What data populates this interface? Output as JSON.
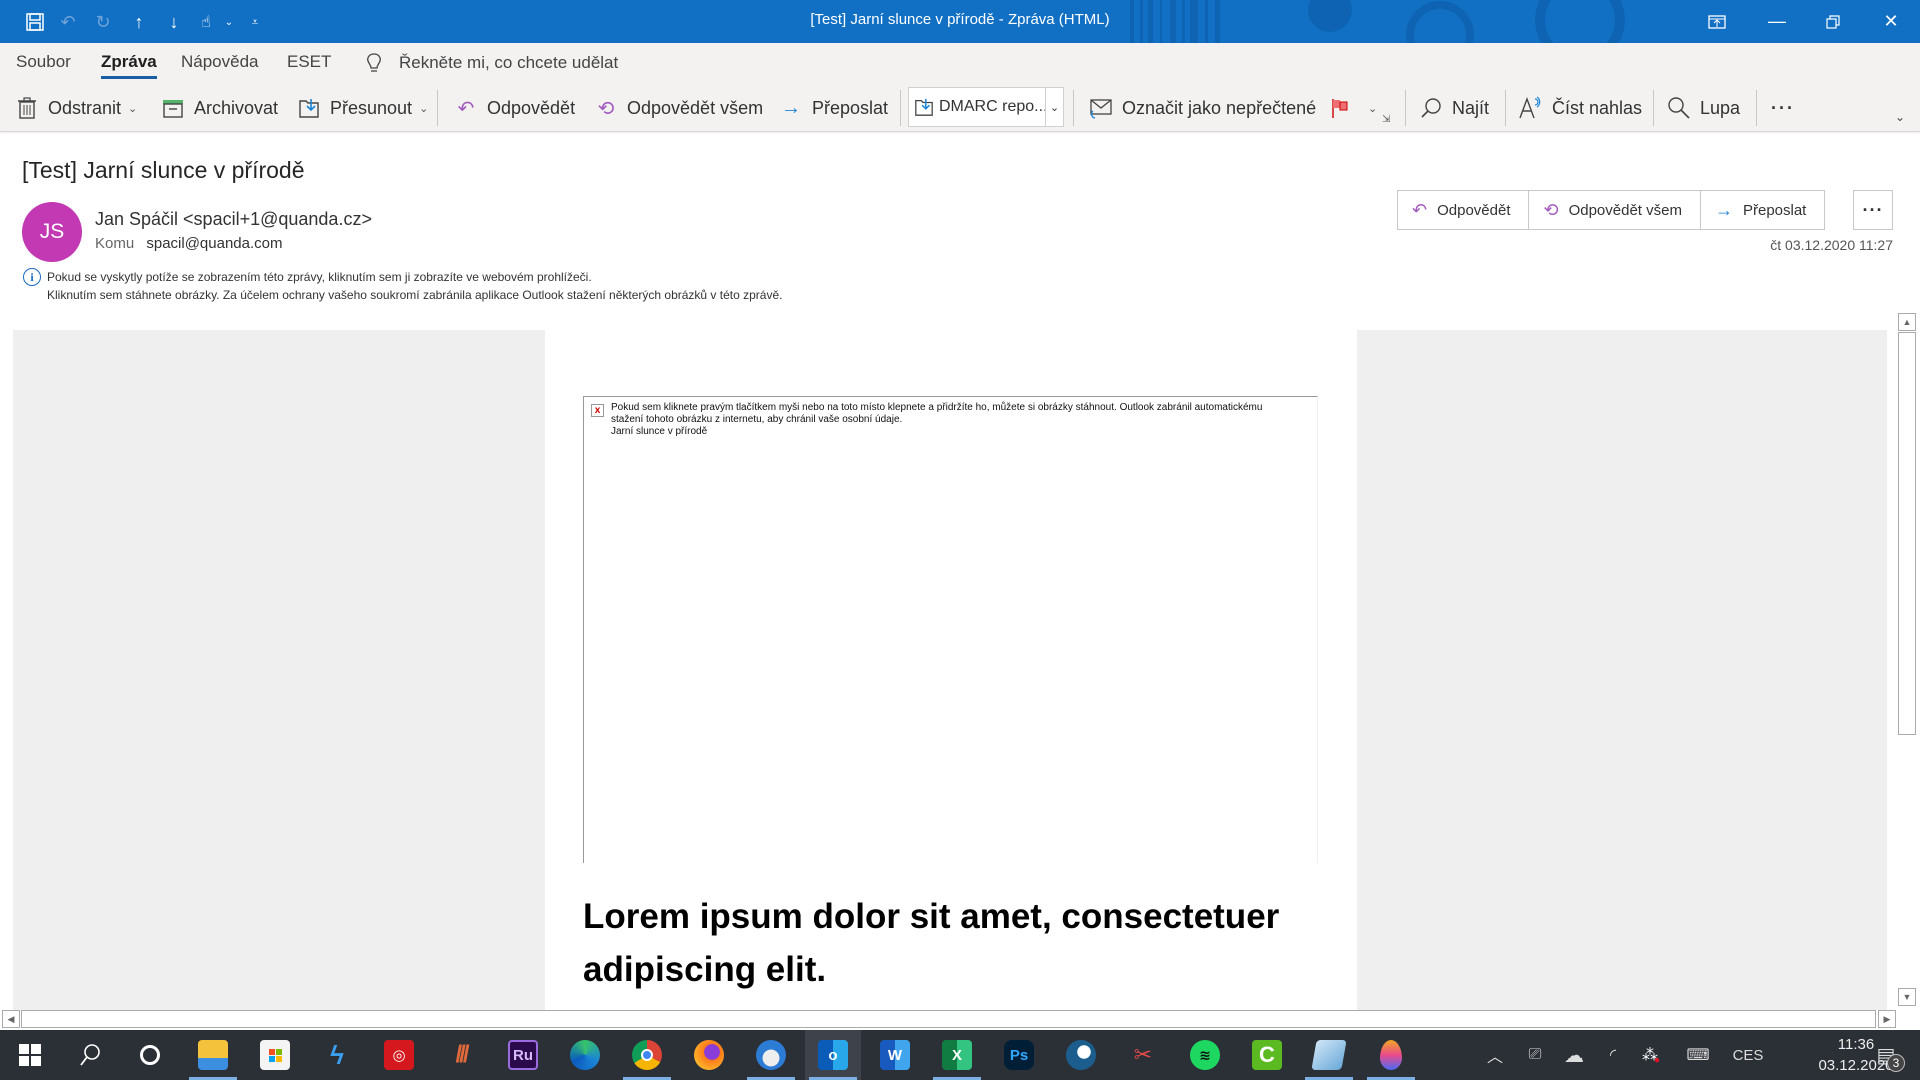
{
  "window": {
    "title": "[Test] Jarní slunce v přírodě  -  Zpráva (HTML)",
    "quick_access": [
      "save-icon",
      "undo-icon",
      "redo-icon",
      "previous-item-icon",
      "next-item-icon",
      "touch-mode-icon",
      "customize-icon"
    ],
    "controls": [
      "ribbon-display-options",
      "minimize",
      "restore",
      "close"
    ]
  },
  "tabs": [
    {
      "label": "Soubor",
      "active": false
    },
    {
      "label": "Zpráva",
      "active": true
    },
    {
      "label": "Nápověda",
      "active": false
    },
    {
      "label": "ESET",
      "active": false
    }
  ],
  "tell_me": {
    "placeholder": "Řekněte mi, co chcete udělat"
  },
  "ribbon": {
    "delete": "Odstranit",
    "archive": "Archivovat",
    "move": "Přesunout",
    "reply": "Odpovědět",
    "reply_all": "Odpovědět všem",
    "forward": "Přeposlat",
    "quick_step": "DMARC repo...",
    "mark_unread": "Označit jako nepřečtené",
    "find": "Najít",
    "read_aloud": "Číst nahlas",
    "zoom": "Lupa",
    "more": "···"
  },
  "message": {
    "subject": "[Test] Jarní slunce v přírodě",
    "avatar_initials": "JS",
    "avatar_color": "#c239b3",
    "sender": "Jan Spáčil <spacil+1@quanda.cz>",
    "to_label": "Komu",
    "to": "spacil@quanda.com",
    "info_line1": "Pokud se vyskytly potíže se zobrazením této zprávy, kliknutím sem ji zobrazíte ve webovém prohlížeči.",
    "info_line2": "Kliknutím sem stáhnete obrázky. Za účelem ochrany vašeho soukromí zabránila aplikace Outlook stažení některých obrázků v této zprávě.",
    "actions": {
      "reply": "Odpovědět",
      "reply_all": "Odpovědět všem",
      "forward": "Přeposlat",
      "more": "···"
    },
    "datetime": "čt 03.12.2020 11:27"
  },
  "body": {
    "blocked_image_text": "Pokud sem kliknete pravým tlačítkem myši nebo na toto místo klepnete a přidržíte ho, můžete si obrázky stáhnout. Outlook zabránil automatickému stažení tohoto obrázku z internetu, aby chránil vaše osobní údaje.",
    "blocked_image_alt": "Jarní slunce v přírodě",
    "heading": "Lorem ipsum dolor sit amet, consectetuer adipiscing elit."
  },
  "taskbar": {
    "apps": [
      "Start",
      "Search",
      "Cortana",
      "File Explorer",
      "Microsoft Store",
      "Sublime/App",
      "Creative Cloud",
      "App",
      "Premiere Rush",
      "Edge",
      "Chrome",
      "Firefox",
      "Thunderbird",
      "Outlook",
      "Word",
      "Excel",
      "Photoshop Express",
      "Steam",
      "Snipping Tool",
      "Spotify",
      "Camtasia",
      "Notepad",
      "Color Picker"
    ],
    "language": "CES",
    "time": "11:36",
    "date": "03.12.2020",
    "notifications": "3"
  }
}
